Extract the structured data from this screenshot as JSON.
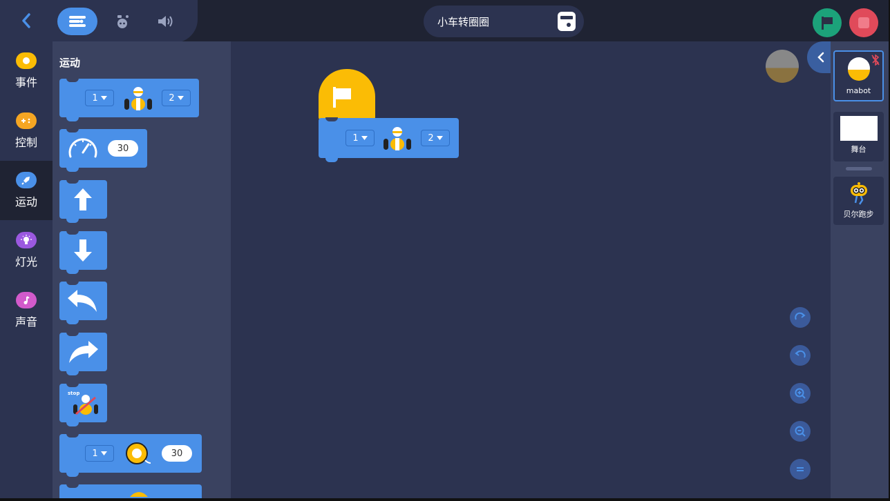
{
  "header": {
    "project_title": "小车转圈圈",
    "tabs": [
      "code-tab",
      "device-tab",
      "sound-tab"
    ]
  },
  "categories": [
    {
      "label": "事件",
      "color": "#fbbc05"
    },
    {
      "label": "控制",
      "color": "#f5a623"
    },
    {
      "label": "运动",
      "color": "#4a90e8"
    },
    {
      "label": "灯光",
      "color": "#9b59e0"
    },
    {
      "label": "声音",
      "color": "#d25acb"
    }
  ],
  "palette": {
    "title": "运动",
    "blocks": {
      "motor_pair_left": "1",
      "motor_pair_right": "2",
      "speed_value": "30",
      "stop_label": "stop",
      "wheel_port": "1",
      "wheel_value": "30"
    }
  },
  "workspace": {
    "block_left": "1",
    "block_right": "2"
  },
  "sprites": [
    {
      "label": "mabot"
    },
    {
      "label": "舞台"
    },
    {
      "label": "贝尔跑步"
    }
  ],
  "colors": {
    "accent": "#4a90e8",
    "event": "#fbbc05",
    "run": "#1ca27a",
    "stop": "#e04a5a"
  }
}
